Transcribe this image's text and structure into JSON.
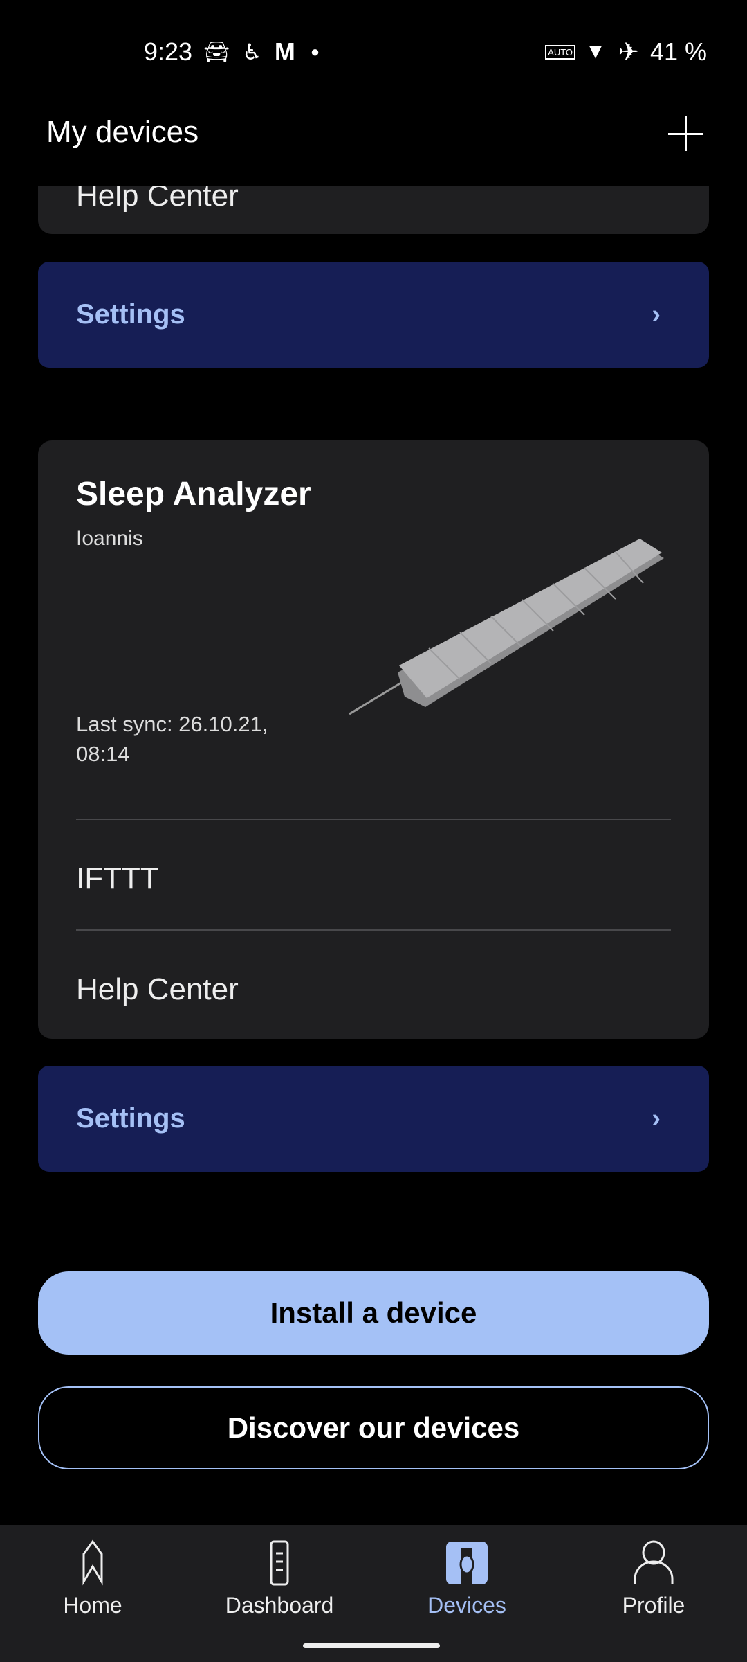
{
  "status_bar": {
    "time": "9:23",
    "battery": "41 %",
    "left_icons": [
      "car-icon",
      "accessibility-icon",
      "gmail-icon",
      "dot-icon"
    ],
    "right_icons": [
      "auto-hz-icon",
      "wifi-icon",
      "airplane-icon"
    ]
  },
  "header": {
    "title": "My devices",
    "add_icon": "plus-icon"
  },
  "prev_card": {
    "help_center": "Help Center"
  },
  "settings_label": "Settings",
  "device": {
    "name": "Sleep Analyzer",
    "owner": "Ioannis",
    "last_sync": "Last sync: 26.10.21,",
    "last_sync_time": "08:14",
    "items": [
      "IFTTT",
      "Help Center"
    ]
  },
  "buttons": {
    "install": "Install a device",
    "discover": "Discover our devices"
  },
  "nav": {
    "items": [
      {
        "label": "Home",
        "icon": "home-icon"
      },
      {
        "label": "Dashboard",
        "icon": "dashboard-icon"
      },
      {
        "label": "Devices",
        "icon": "devices-icon",
        "active": true
      },
      {
        "label": "Profile",
        "icon": "profile-icon"
      }
    ]
  },
  "colors": {
    "accent": "#a5c0f5",
    "settings_bg": "#161e55",
    "card_bg": "#1f1f21"
  }
}
